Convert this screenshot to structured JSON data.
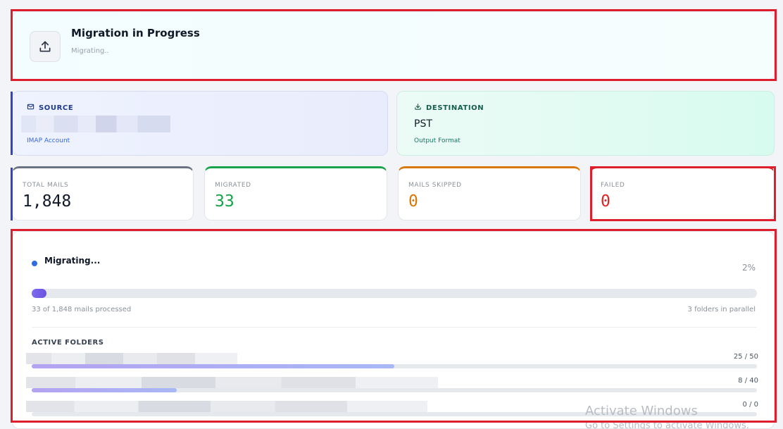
{
  "header": {
    "title": "Migration in Progress",
    "subtitle": "Migrating..",
    "icon": "upload-icon"
  },
  "source": {
    "label": "SOURCE",
    "icon": "mail-icon",
    "account_type": "IMAP Account"
  },
  "destination": {
    "label": "DESTINATION",
    "icon": "download-icon",
    "format": "PST",
    "format_label": "Output Format"
  },
  "stats": {
    "total": {
      "label": "TOTAL MAILS",
      "value": "1,848"
    },
    "migrated": {
      "label": "MIGRATED",
      "value": "33"
    },
    "skipped": {
      "label": "MAILS SKIPPED",
      "value": "0"
    },
    "failed": {
      "label": "FAILED",
      "value": "0"
    }
  },
  "progress": {
    "status": "Migrating...",
    "percent_text": "2%",
    "percent_value": 2,
    "processed_text": "33 of 1,848 mails processed",
    "parallel_text": "3 folders in parallel"
  },
  "active_folders": {
    "title": "ACTIVE FOLDERS",
    "items": [
      {
        "count": "25 / 50",
        "fraction": 0.5
      },
      {
        "count": "8 / 40",
        "fraction": 0.2
      },
      {
        "count": "0 / 0",
        "fraction": 0
      }
    ]
  },
  "watermark": {
    "title": "Activate Windows",
    "subtitle": "Go to Settings to activate Windows."
  },
  "colors": {
    "migrated": "#17a34a",
    "skipped": "#d97706",
    "failed": "#dc2626",
    "accent": "#2f6ce0",
    "annotation": "#dc1e2d"
  }
}
